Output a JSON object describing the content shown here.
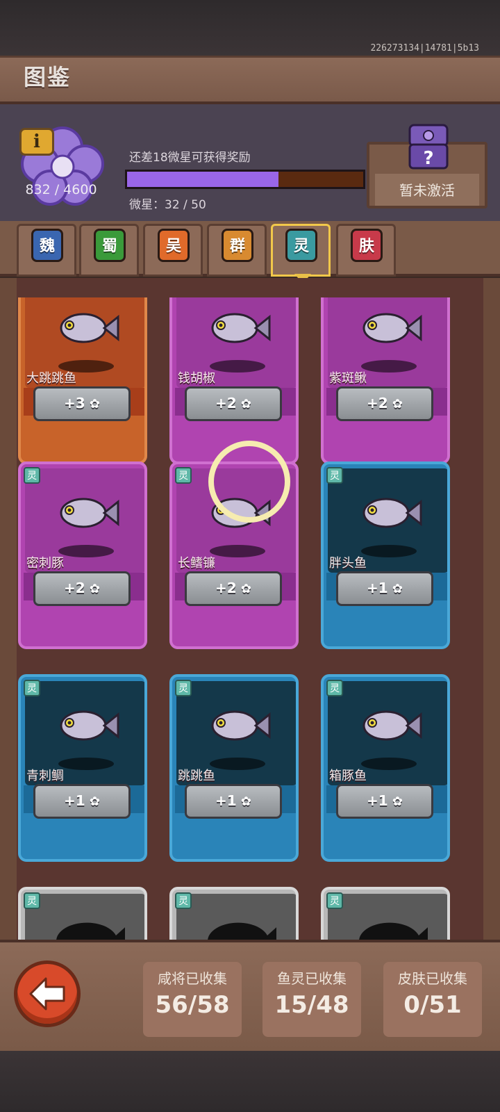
{
  "build_id": "226273134|14781|5b13",
  "title": "图鉴",
  "header": {
    "info_icon": "info-icon",
    "collection_count": "832 / 4600",
    "hint": "还差18微星可获得奖励",
    "progress": 0.64,
    "stars_label": "微星：32 / 50",
    "reward_status": "暂未激活"
  },
  "tabs": [
    {
      "label": "魏",
      "color": "#3a66b0"
    },
    {
      "label": "蜀",
      "color": "#3a9a3a"
    },
    {
      "label": "吴",
      "color": "#e06a2a"
    },
    {
      "label": "群",
      "color": "#d88a30"
    },
    {
      "label": "灵",
      "color": "#3a9aa0",
      "active": true
    },
    {
      "label": "肤",
      "color": "#c83a4a"
    }
  ],
  "cards": [
    {
      "name": "大跳跳鱼",
      "tag": "",
      "stars": 1,
      "reward": "+3",
      "color": "orange"
    },
    {
      "name": "钱胡椒",
      "tag": "",
      "stars": 1,
      "reward": "+2",
      "color": "purple"
    },
    {
      "name": "紫斑鳅",
      "tag": "",
      "stars": 1,
      "reward": "+2",
      "color": "purple"
    },
    {
      "name": "密刺豚",
      "tag": "灵",
      "stars": 1,
      "reward": "+2",
      "color": "purple"
    },
    {
      "name": "长鳍镰",
      "tag": "灵",
      "stars": 1,
      "reward": "+2",
      "color": "purple"
    },
    {
      "name": "胖头鱼",
      "tag": "灵",
      "stars": 1,
      "reward": "+1",
      "color": "blue"
    },
    {
      "name": "青刺鲷",
      "tag": "灵",
      "stars": 1,
      "reward": "+1",
      "color": "blue"
    },
    {
      "name": "跳跳鱼",
      "tag": "灵",
      "stars": 1,
      "reward": "+1",
      "color": "blue"
    },
    {
      "name": "箱豚鱼",
      "tag": "灵",
      "stars": 1,
      "reward": "+1",
      "color": "blue"
    },
    {
      "name": "",
      "tag": "灵",
      "stars": 0,
      "reward": "",
      "color": "grey"
    },
    {
      "name": "",
      "tag": "灵",
      "stars": 0,
      "reward": "",
      "color": "grey"
    },
    {
      "name": "",
      "tag": "灵",
      "stars": 0,
      "reward": "",
      "color": "grey"
    }
  ],
  "stats": [
    {
      "label": "咸将已收集",
      "value": "56/58"
    },
    {
      "label": "鱼灵已收集",
      "value": "15/48"
    },
    {
      "label": "皮肤已收集",
      "value": "0/51"
    }
  ]
}
